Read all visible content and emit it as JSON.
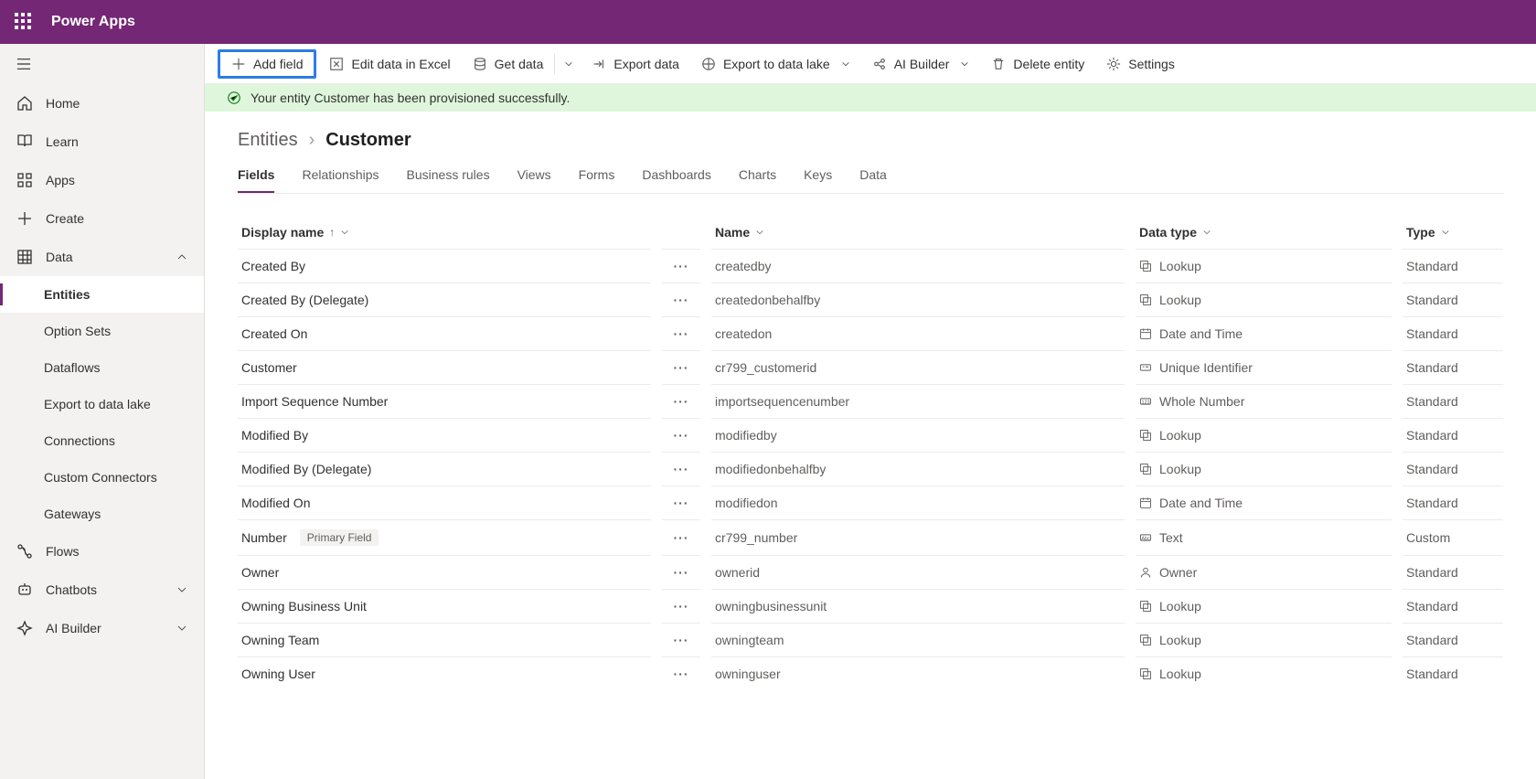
{
  "brand": {
    "title": "Power Apps"
  },
  "sidebar": {
    "items": [
      {
        "label": "Home"
      },
      {
        "label": "Learn"
      },
      {
        "label": "Apps"
      },
      {
        "label": "Create"
      },
      {
        "label": "Data"
      },
      {
        "label": "Entities"
      },
      {
        "label": "Option Sets"
      },
      {
        "label": "Dataflows"
      },
      {
        "label": "Export to data lake"
      },
      {
        "label": "Connections"
      },
      {
        "label": "Custom Connectors"
      },
      {
        "label": "Gateways"
      },
      {
        "label": "Flows"
      },
      {
        "label": "Chatbots"
      },
      {
        "label": "AI Builder"
      }
    ]
  },
  "cmdbar": {
    "add_field": "Add field",
    "edit_excel": "Edit data in Excel",
    "get_data": "Get data",
    "export_data": "Export data",
    "export_lake": "Export to data lake",
    "ai_builder": "AI Builder",
    "delete_entity": "Delete entity",
    "settings": "Settings"
  },
  "notification": {
    "message": "Your entity Customer has been provisioned successfully."
  },
  "breadcrumb": {
    "parent": "Entities",
    "current": "Customer"
  },
  "tabs": [
    {
      "label": "Fields"
    },
    {
      "label": "Relationships"
    },
    {
      "label": "Business rules"
    },
    {
      "label": "Views"
    },
    {
      "label": "Forms"
    },
    {
      "label": "Dashboards"
    },
    {
      "label": "Charts"
    },
    {
      "label": "Keys"
    },
    {
      "label": "Data"
    }
  ],
  "columns": {
    "display_name": "Display name",
    "name": "Name",
    "data_type": "Data type",
    "type": "Type"
  },
  "badge_primary": "Primary Field",
  "rows": [
    {
      "display": "Created By",
      "name": "createdby",
      "datatype": "Lookup",
      "dticon": "lookup",
      "type": "Standard"
    },
    {
      "display": "Created By (Delegate)",
      "name": "createdonbehalfby",
      "datatype": "Lookup",
      "dticon": "lookup",
      "type": "Standard"
    },
    {
      "display": "Created On",
      "name": "createdon",
      "datatype": "Date and Time",
      "dticon": "datetime",
      "type": "Standard"
    },
    {
      "display": "Customer",
      "name": "cr799_customerid",
      "datatype": "Unique Identifier",
      "dticon": "uid",
      "type": "Standard"
    },
    {
      "display": "Import Sequence Number",
      "name": "importsequencenumber",
      "datatype": "Whole Number",
      "dticon": "number",
      "type": "Standard"
    },
    {
      "display": "Modified By",
      "name": "modifiedby",
      "datatype": "Lookup",
      "dticon": "lookup",
      "type": "Standard"
    },
    {
      "display": "Modified By (Delegate)",
      "name": "modifiedonbehalfby",
      "datatype": "Lookup",
      "dticon": "lookup",
      "type": "Standard"
    },
    {
      "display": "Modified On",
      "name": "modifiedon",
      "datatype": "Date and Time",
      "dticon": "datetime",
      "type": "Standard"
    },
    {
      "display": "Number",
      "name": "cr799_number",
      "datatype": "Text",
      "dticon": "text",
      "type": "Custom",
      "badge": true
    },
    {
      "display": "Owner",
      "name": "ownerid",
      "datatype": "Owner",
      "dticon": "owner",
      "type": "Standard"
    },
    {
      "display": "Owning Business Unit",
      "name": "owningbusinessunit",
      "datatype": "Lookup",
      "dticon": "lookup",
      "type": "Standard"
    },
    {
      "display": "Owning Team",
      "name": "owningteam",
      "datatype": "Lookup",
      "dticon": "lookup",
      "type": "Standard"
    },
    {
      "display": "Owning User",
      "name": "owninguser",
      "datatype": "Lookup",
      "dticon": "lookup",
      "type": "Standard"
    }
  ]
}
